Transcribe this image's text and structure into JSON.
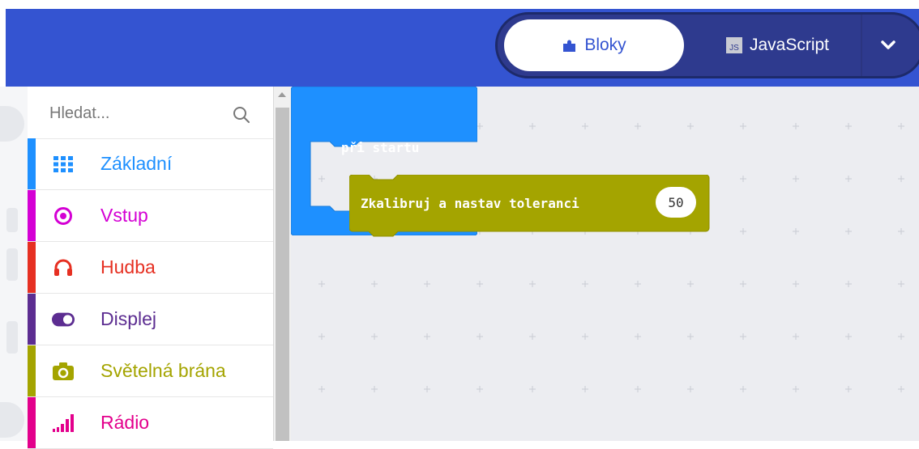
{
  "header": {
    "tab_blocks": "Bloky",
    "tab_javascript": "JavaScript",
    "js_badge": "JS",
    "bg_color": "#3454d1"
  },
  "toolbox": {
    "search_placeholder": "Hledat...",
    "categories": [
      {
        "label": "Základní",
        "color": "#1e90ff",
        "icon": "grid-icon"
      },
      {
        "label": "Vstup",
        "color": "#d400d4",
        "icon": "target-icon"
      },
      {
        "label": "Hudba",
        "color": "#e63022",
        "icon": "headphones-icon"
      },
      {
        "label": "Displej",
        "color": "#5c2d91",
        "icon": "toggle-icon"
      },
      {
        "label": "Světelná brána",
        "color": "#a4a400",
        "icon": "camera-icon"
      },
      {
        "label": "Rádio",
        "color": "#e3008c",
        "icon": "signal-bars-icon"
      }
    ]
  },
  "workspace": {
    "onstart_label": "při startu",
    "onstart_color": "#1e90ff",
    "calibrate_label": "Zkalibruj a nastav toleranci",
    "calibrate_color": "#a4a400",
    "calibrate_value": "50"
  }
}
